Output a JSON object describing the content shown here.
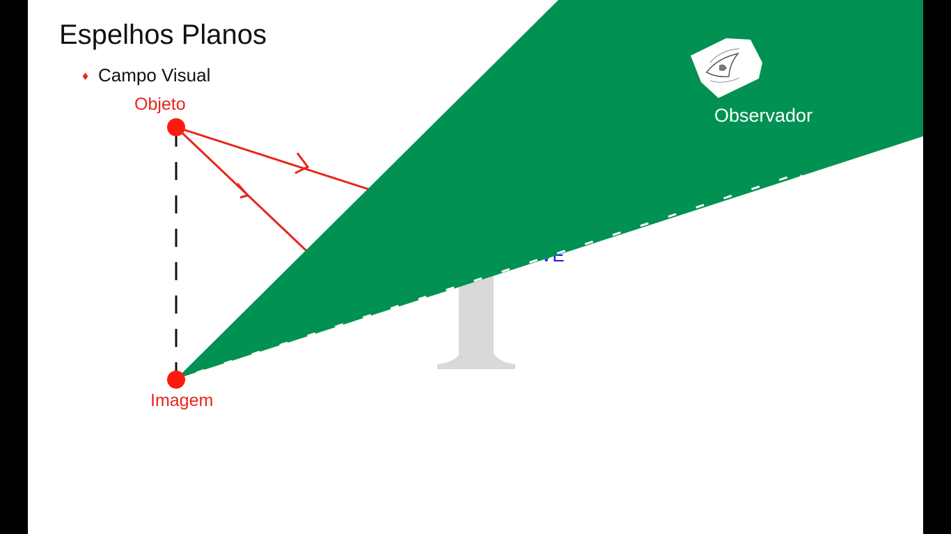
{
  "slide": {
    "title": "Espelhos Planos",
    "bullet": "Campo Visual"
  },
  "labels": {
    "object": "Objeto",
    "image": "Imagem",
    "observer": "Observador",
    "partial_blue": "VE"
  },
  "colors": {
    "background": "#ffffff",
    "side_bars": "#000000",
    "rays": "#e8251a",
    "field_of_view": "#019152",
    "mirror_watermark": "#d9d9d9",
    "partial_blue": "#1a1aff",
    "text": "#111111"
  },
  "icons": {
    "bullet": "diamond-bullet-icon",
    "observer": "eye-sketch-icon"
  }
}
